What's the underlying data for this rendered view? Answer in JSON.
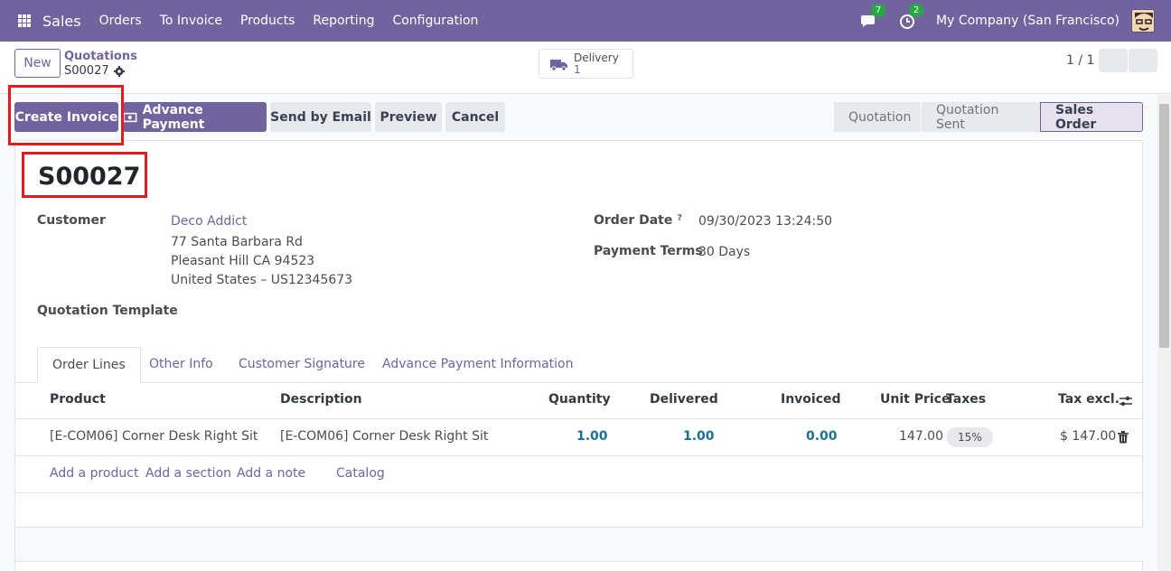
{
  "navbar": {
    "brand": "Sales",
    "menu": [
      "Orders",
      "To Invoice",
      "Products",
      "Reporting",
      "Configuration"
    ],
    "messages_count": "7",
    "activities_count": "2",
    "company": "My Company (San Francisco)"
  },
  "control_panel": {
    "new_label": "New",
    "breadcrumb_parent": "Quotations",
    "breadcrumb_current": "S00027",
    "smart_button": {
      "label": "Delivery",
      "value": "1"
    },
    "pager": "1 / 1"
  },
  "actions": {
    "create_invoice": "Create Invoice",
    "advance_payment": "Advance Payment",
    "send_email": "Send by Email",
    "preview": "Preview",
    "cancel": "Cancel"
  },
  "statusbar": {
    "stages": [
      "Quotation",
      "Quotation Sent",
      "Sales Order"
    ],
    "active": "Sales Order"
  },
  "form": {
    "title": "S00027",
    "customer_label": "Customer",
    "customer_name": "Deco Addict",
    "address_line1": "77 Santa Barbara Rd",
    "address_line2": "Pleasant Hill CA 94523",
    "address_line3": "United States – US12345673",
    "template_label": "Quotation Template",
    "order_date_label": "Order Date",
    "order_date_help": "?",
    "order_date": "09/30/2023 13:24:50",
    "payment_terms_label": "Payment Terms",
    "payment_terms": "30 Days"
  },
  "tabs": [
    "Order Lines",
    "Other Info",
    "Customer Signature",
    "Advance Payment Information"
  ],
  "table": {
    "headers": [
      "Product",
      "Description",
      "Quantity",
      "Delivered",
      "Invoiced",
      "Unit Price",
      "Taxes",
      "Tax excl."
    ],
    "rows": [
      {
        "product": "[E-COM06] Corner Desk Right Sit",
        "description": "[E-COM06] Corner Desk Right Sit",
        "quantity": "1.00",
        "delivered": "1.00",
        "invoiced": "0.00",
        "unit_price": "147.00",
        "taxes": "15%",
        "subtotal": "$ 147.00"
      }
    ],
    "add_links": [
      "Add a product",
      "Add a section",
      "Add a note",
      "Catalog"
    ]
  },
  "colors": {
    "brand": "#71639e",
    "annotation": "#e5191f"
  }
}
